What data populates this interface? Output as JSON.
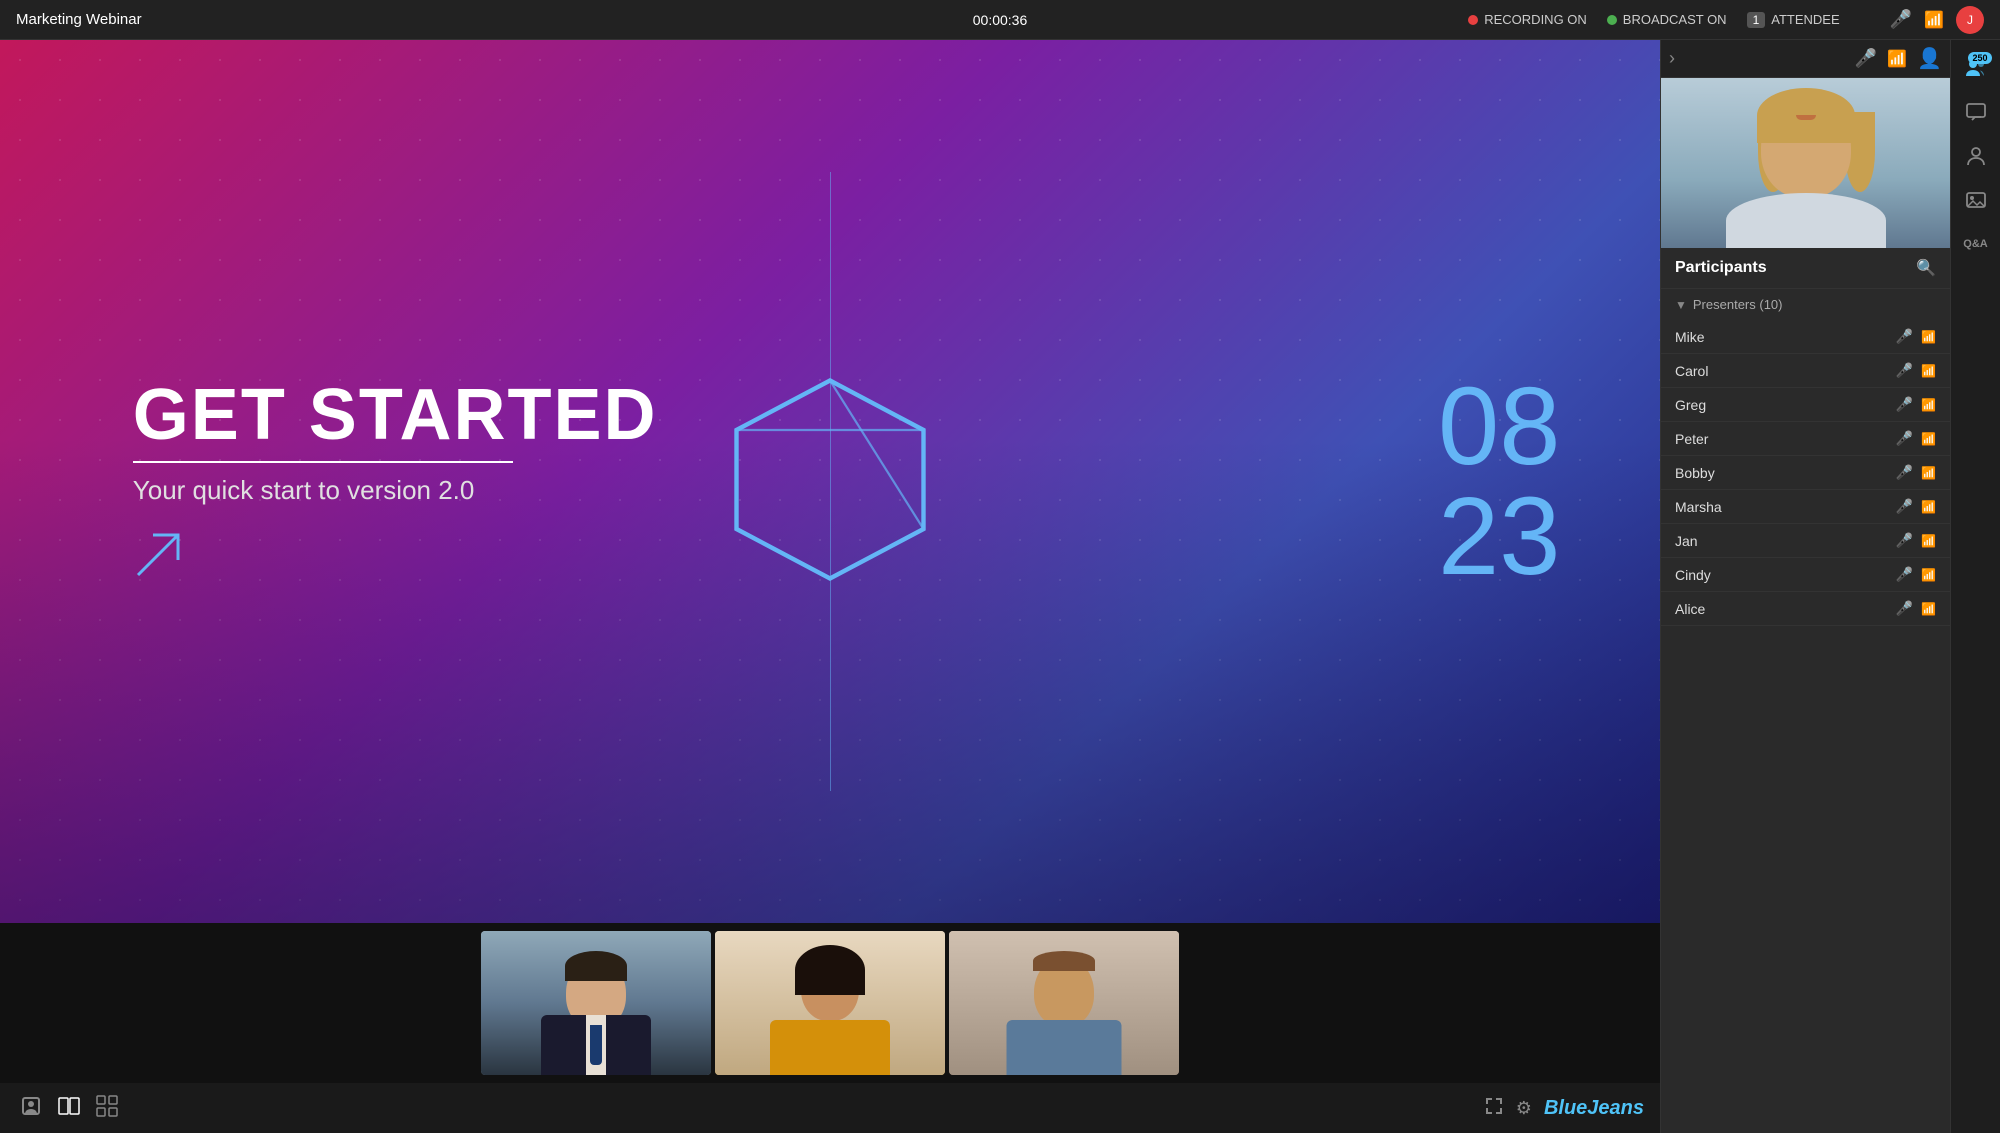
{
  "topbar": {
    "title": "Marketing Webinar",
    "timer": "00:00:36",
    "recording_label": "RECORDING ON",
    "broadcast_label": "BROADCAST ON",
    "attendee_count": "1",
    "attendee_label": "ATTENDEE"
  },
  "slide": {
    "title": "GET STARTED",
    "subtitle": "Your quick start to version 2.0",
    "number1": "08",
    "number2": "23"
  },
  "participants": {
    "panel_title": "Participants",
    "group_label": "Presenters (10)",
    "presenters": [
      {
        "name": "Mike"
      },
      {
        "name": "Carol"
      },
      {
        "name": "Greg"
      },
      {
        "name": "Peter"
      },
      {
        "name": "Bobby"
      },
      {
        "name": "Marsha"
      },
      {
        "name": "Jan"
      },
      {
        "name": "Cindy"
      },
      {
        "name": "Alice"
      }
    ]
  },
  "sidebar_nav": {
    "attendee_count": "250",
    "chat_icon": "💬",
    "people_icon": "👥",
    "image_icon": "🖼",
    "qa_label": "Q&A"
  },
  "bottom": {
    "bluejeans_logo": "BlueJeans",
    "fullscreen_tip": "Fullscreen",
    "settings_tip": "Settings"
  }
}
